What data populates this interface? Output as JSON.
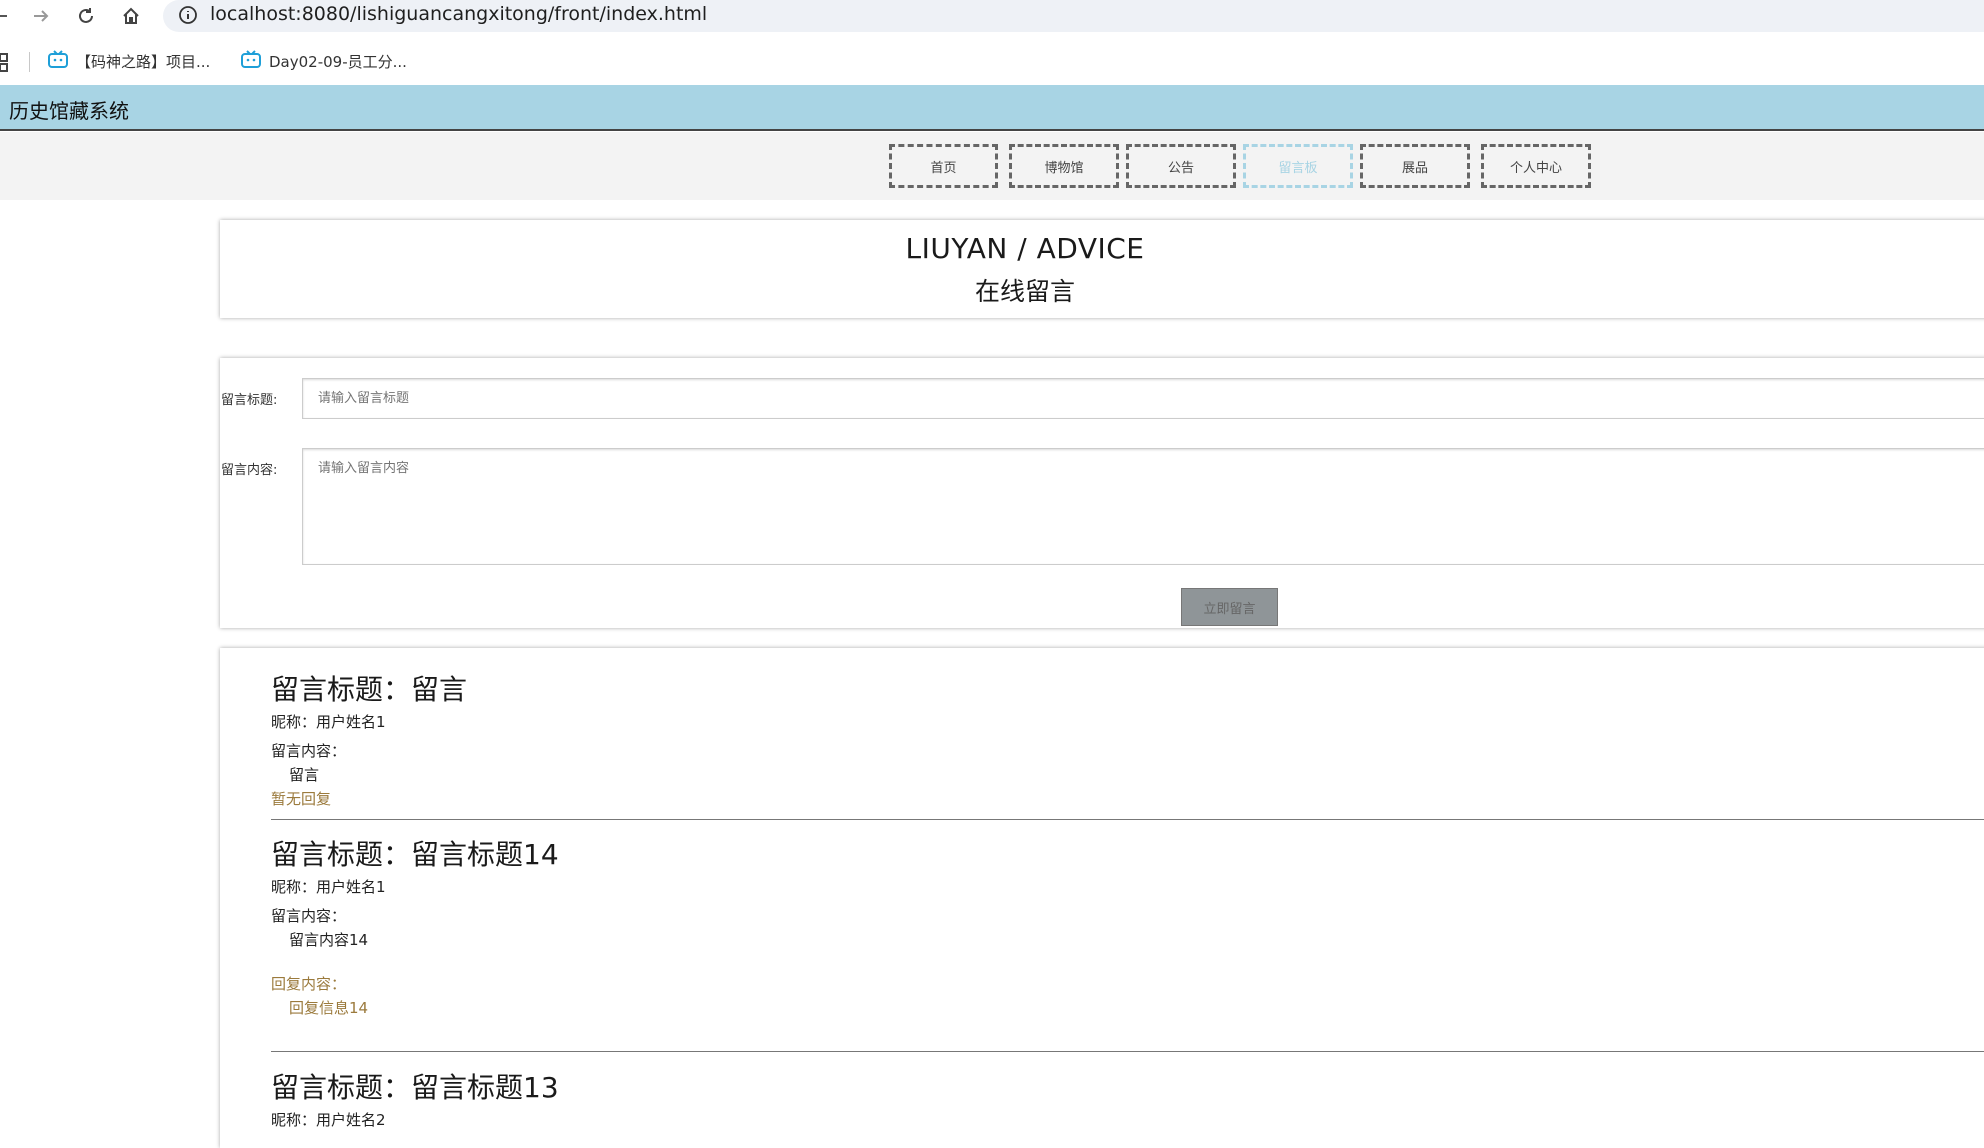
{
  "browser": {
    "url": "localhost:8080/lishiguancangxitong/front/index.html",
    "bookmarks": [
      {
        "label": "【码神之路】项目..."
      },
      {
        "label": "Day02-09-员工分..."
      }
    ]
  },
  "site": {
    "title": "历史馆藏系统",
    "nav": [
      {
        "label": "首页"
      },
      {
        "label": "博物馆"
      },
      {
        "label": "公告"
      },
      {
        "label": "留言板"
      },
      {
        "label": "展品"
      },
      {
        "label": "个人中心"
      }
    ],
    "active_nav": "留言板",
    "accent_color": "#a8d4e4",
    "reply_color": "#9b7a3c"
  },
  "heading": {
    "en": "LIUYAN / ADVICE",
    "cn": "在线留言"
  },
  "form": {
    "title_label": "留言标题:",
    "title_placeholder": "请输入留言标题",
    "content_label": "留言内容:",
    "content_placeholder": "请输入留言内容",
    "submit_label": "立即留言"
  },
  "messages": [
    {
      "title": "留言标题：留言",
      "nickname": "昵称：用户姓名1",
      "content_label": "留言内容：",
      "content": "留言",
      "reply_status": "暂无回复"
    },
    {
      "title": "留言标题：留言标题14",
      "nickname": "昵称：用户姓名1",
      "content_label": "留言内容：",
      "content": "留言内容14",
      "reply_label": "回复内容：",
      "reply": "回复信息14"
    },
    {
      "title": "留言标题：留言标题13",
      "nickname": "昵称：用户姓名2"
    }
  ]
}
